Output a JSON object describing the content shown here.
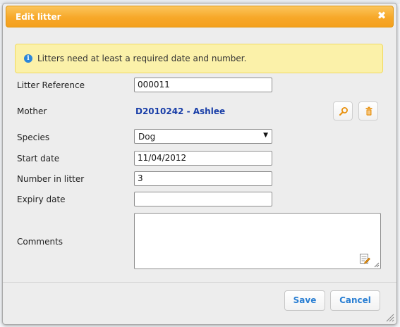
{
  "dialog": {
    "title": "Edit litter",
    "close_glyph": "✖"
  },
  "notice": {
    "icon": "info-icon",
    "text": "Litters need at least a required date and number."
  },
  "form": {
    "litter_reference": {
      "label": "Litter Reference",
      "value": "000011"
    },
    "mother": {
      "label": "Mother",
      "value": "D2010242 - Ashlee",
      "search_icon": "search-icon",
      "delete_icon": "trash-icon"
    },
    "species": {
      "label": "Species",
      "value": "Dog"
    },
    "start_date": {
      "label": "Start date",
      "value": "11/04/2012"
    },
    "number_in_litter": {
      "label": "Number in litter",
      "value": "3"
    },
    "expiry_date": {
      "label": "Expiry date",
      "value": ""
    },
    "comments": {
      "label": "Comments",
      "value": "",
      "edit_icon": "edit-notes-icon"
    }
  },
  "buttons": {
    "save": "Save",
    "cancel": "Cancel"
  },
  "colors": {
    "titlebar": "#f7a829",
    "notice_bg": "#fbf1a9",
    "link": "#1a3fa8",
    "button_text": "#2a7fd3",
    "icon_accent": "#e8900c"
  }
}
